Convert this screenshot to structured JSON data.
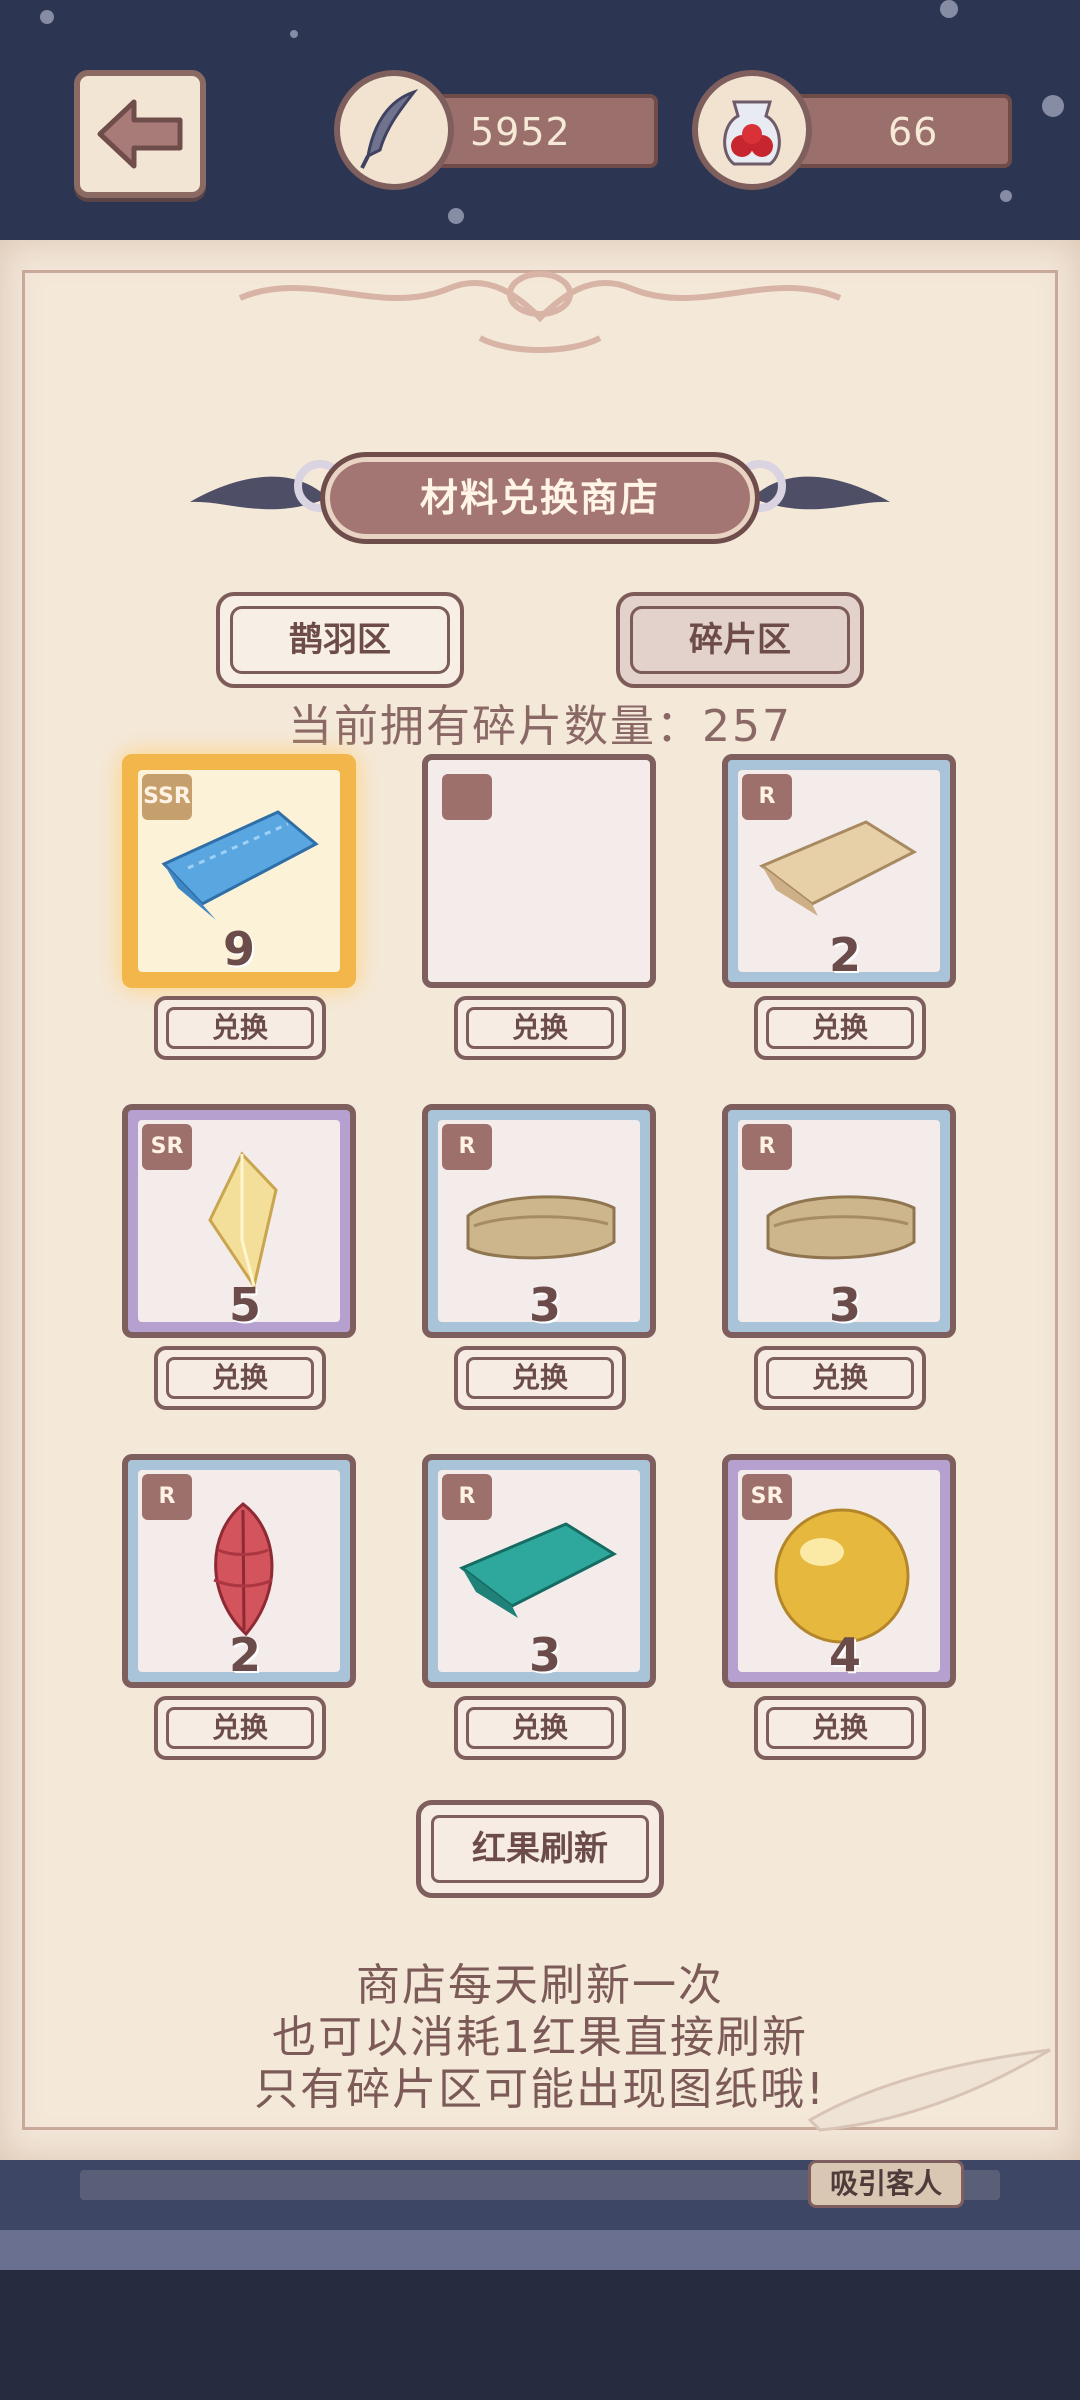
{
  "header": {
    "feather_count": "5952",
    "berry_count": "66",
    "back_icon": "arrow-left-icon",
    "feather_icon": "feather-icon",
    "berry_icon": "red-berry-jar-icon"
  },
  "shop": {
    "title": "材料兑换商店",
    "tabs": [
      {
        "label": "鹊羽区",
        "selected": false
      },
      {
        "label": "碎片区",
        "selected": true
      }
    ],
    "fragment_count_line": "当前拥有碎片数量：257",
    "items": [
      {
        "rarity": "SSR",
        "item": "blue-fabric-icon",
        "qty": "9",
        "highlight": true,
        "button": "兑换"
      },
      {
        "rarity": "",
        "item": "",
        "qty": "",
        "highlight": false,
        "button": "兑换"
      },
      {
        "rarity": "R",
        "item": "beige-fabric-icon",
        "qty": "2",
        "highlight": false,
        "button": "兑换"
      },
      {
        "rarity": "SR",
        "item": "yellow-crystal-icon",
        "qty": "5",
        "highlight": false,
        "button": "兑换"
      },
      {
        "rarity": "R",
        "item": "khaki-cloth-icon",
        "qty": "3",
        "highlight": false,
        "button": "兑换"
      },
      {
        "rarity": "R",
        "item": "khaki-cloth-icon",
        "qty": "3",
        "highlight": false,
        "button": "兑换"
      },
      {
        "rarity": "R",
        "item": "red-feather-icon",
        "qty": "2",
        "highlight": false,
        "button": "兑换"
      },
      {
        "rarity": "R",
        "item": "teal-fabric-icon",
        "qty": "3",
        "highlight": false,
        "button": "兑换"
      },
      {
        "rarity": "SR",
        "item": "golden-pearl-icon",
        "qty": "4",
        "highlight": false,
        "button": "兑换"
      }
    ],
    "refresh_button": "红果刷新",
    "notes": [
      "商店每天刷新一次",
      "也可以消耗1红果直接刷新",
      "只有碎片区可能出现图纸哦!"
    ]
  },
  "background": {
    "attract_guests_label": "吸引客人"
  },
  "colors": {
    "panel": "#f4e8d9",
    "accent": "#a37673",
    "night": "#2c3552",
    "ssr_frame": "#f2b64a",
    "sr_frame": "#b6a0cf",
    "r_frame": "#a9c3d8"
  }
}
